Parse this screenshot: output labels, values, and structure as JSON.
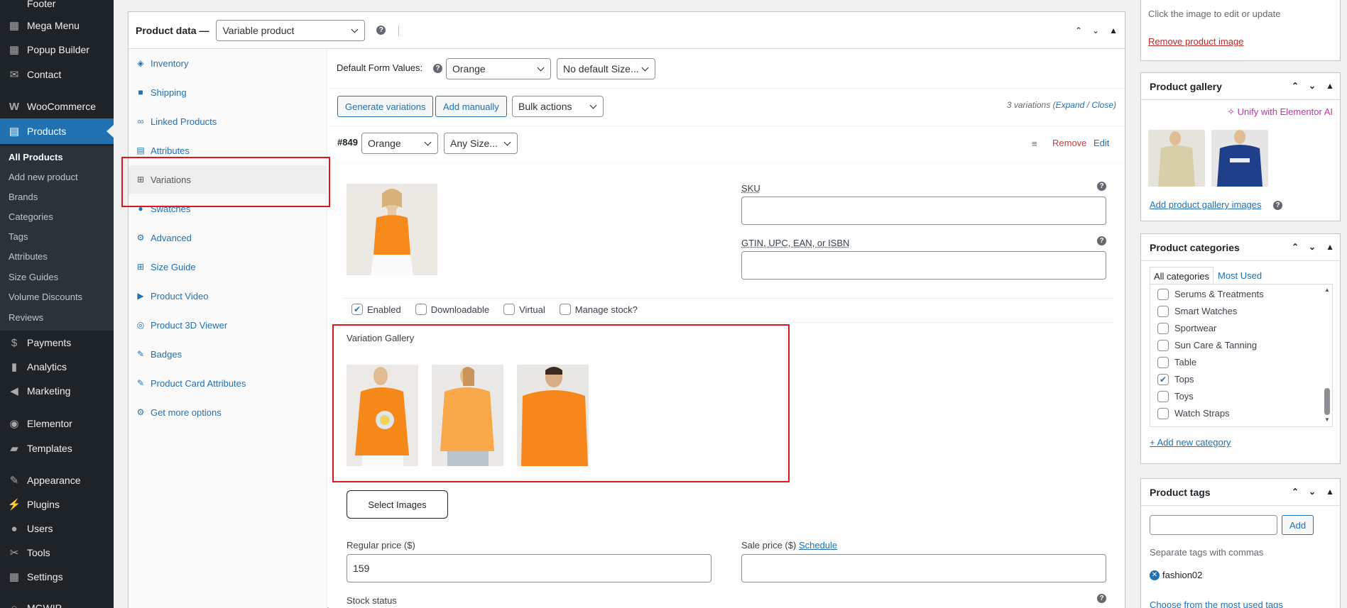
{
  "sidebar": {
    "items_top": [
      {
        "label": "Footer",
        "icon": "footer-icon"
      },
      {
        "label": "Mega Menu",
        "icon": "grid-icon"
      },
      {
        "label": "Popup Builder",
        "icon": "grid-icon"
      },
      {
        "label": "Contact",
        "icon": "mail-icon"
      },
      {
        "label": "WooCommerce",
        "icon": "woo-icon"
      },
      {
        "label": "Products",
        "icon": "archive-icon"
      }
    ],
    "submenu": [
      "All Products",
      "Add new product",
      "Brands",
      "Categories",
      "Tags",
      "Attributes",
      "Size Guides",
      "Volume Discounts",
      "Reviews"
    ],
    "items_bottom": [
      {
        "label": "Payments",
        "icon": "dollar-icon"
      },
      {
        "label": "Analytics",
        "icon": "chart-icon"
      },
      {
        "label": "Marketing",
        "icon": "megaphone-icon"
      },
      {
        "label": "Elementor",
        "icon": "elementor-icon"
      },
      {
        "label": "Templates",
        "icon": "folder-icon"
      },
      {
        "label": "Appearance",
        "icon": "brush-icon"
      },
      {
        "label": "Plugins",
        "icon": "plugin-icon"
      },
      {
        "label": "Users",
        "icon": "user-icon"
      },
      {
        "label": "Tools",
        "icon": "wrench-icon"
      },
      {
        "label": "Settings",
        "icon": "settings-icon"
      },
      {
        "label": "MGWIP",
        "icon": "circle-icon"
      }
    ]
  },
  "product_data": {
    "title": "Product data —",
    "type_select": "Variable product",
    "help": "?",
    "tabs": [
      "Inventory",
      "Shipping",
      "Linked Products",
      "Attributes",
      "Variations",
      "Swatches",
      "Advanced",
      "Size Guide",
      "Product Video",
      "Product 3D Viewer",
      "Badges",
      "Product Card Attributes",
      "Get more options"
    ],
    "default_form_label": "Default Form Values:",
    "default_color": "Orange",
    "default_size": "No default Size...",
    "generate_btn": "Generate variations",
    "add_manually_btn": "Add manually",
    "bulk_actions": "Bulk actions",
    "variations_count": "3 variations",
    "expand": "Expand",
    "slash": "/",
    "close": "Close",
    "variation": {
      "id": "#849",
      "color": "Orange",
      "size": "Any Size...",
      "remove": "Remove",
      "edit": "Edit",
      "sku_label": "SKU",
      "gtin_label": "GTIN, UPC, EAN, or ISBN",
      "checks": [
        {
          "label": "Enabled",
          "checked": true
        },
        {
          "label": "Downloadable",
          "checked": false
        },
        {
          "label": "Virtual",
          "checked": false
        },
        {
          "label": "Manage stock?",
          "checked": false
        }
      ],
      "gallery_label": "Variation Gallery",
      "select_images": "Select Images",
      "regular_price_label": "Regular price ($)",
      "regular_price": "159",
      "sale_price_label": "Sale price ($)",
      "schedule": "Schedule",
      "stock_status_label": "Stock status"
    }
  },
  "right": {
    "image_hint": "Click the image to edit or update",
    "remove_image": "Remove product image",
    "gallery_title": "Product gallery",
    "unify_ai": "Unify with Elementor AI",
    "add_gallery": "Add product gallery images",
    "categories_title": "Product categories",
    "cat_tabs": [
      "All categories",
      "Most Used"
    ],
    "categories": [
      {
        "label": "Serums & Treatments",
        "checked": false
      },
      {
        "label": "Smart Watches",
        "checked": false
      },
      {
        "label": "Sportwear",
        "checked": false
      },
      {
        "label": "Sun Care & Tanning",
        "checked": false
      },
      {
        "label": "Table",
        "checked": false
      },
      {
        "label": "Tops",
        "checked": true
      },
      {
        "label": "Toys",
        "checked": false
      },
      {
        "label": "Watch Straps",
        "checked": false
      }
    ],
    "add_category": "+ Add new category",
    "tags_title": "Product tags",
    "add_btn": "Add",
    "tags_hint": "Separate tags with commas",
    "tag": "fashion02",
    "choose_tags": "Choose from the most used tags"
  },
  "colors": {
    "accent": "#2271b1",
    "sidebar": "#1d2327",
    "highlight": "#e1141e",
    "remove": "#d63638"
  }
}
